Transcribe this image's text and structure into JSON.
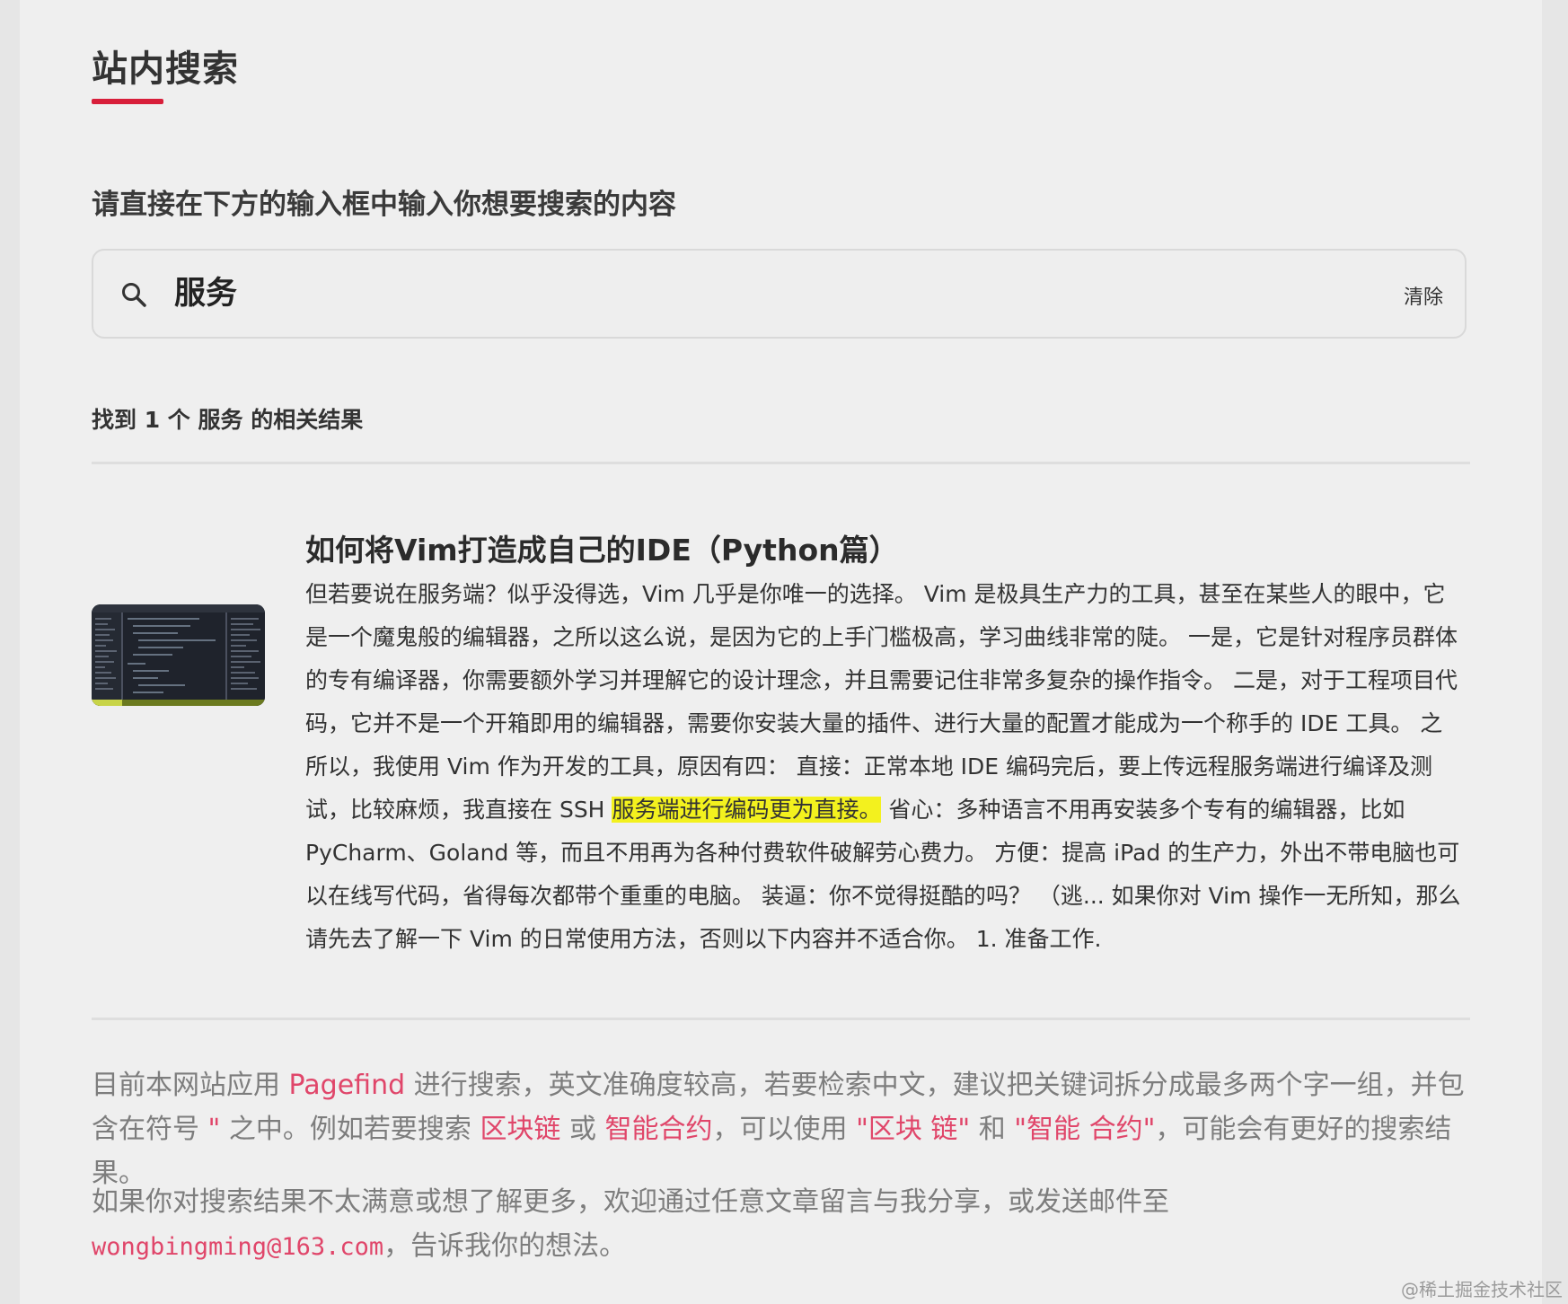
{
  "page": {
    "title": "站内搜索",
    "prompt": "请直接在下方的输入框中输入你想要搜索的内容"
  },
  "search": {
    "value": "服务",
    "clear_label": "清除",
    "icon": "search-icon"
  },
  "results": {
    "count_text": "找到 1 个 服务 的相关结果",
    "items": [
      {
        "title": "如何将Vim打造成自己的IDE（Python篇）",
        "thumbnail": "vim-editor-screenshot",
        "excerpt_before": "但若要说在服务端？似乎没得选，Vim 几乎是你唯一的选择。 Vim 是极具生产力的工具，甚至在某些人的眼中，它是一个魔鬼般的编辑器，之所以这么说，是因为它的上手门槛极高，学习曲线非常的陡。 一是，它是针对程序员群体的专有编译器，你需要额外学习并理解它的设计理念，并且需要记住非常多复杂的操作指令。 二是，对于工程项目代码，它并不是一个开箱即用的编辑器，需要你安装大量的插件、进行大量的配置才能成为一个称手的 IDE 工具。 之所以，我使用 Vim 作为开发的工具，原因有四： 直接：正常本地 IDE 编码完后，要上传远程服务端进行编译及测试，比较麻烦，我直接在 SSH ",
        "excerpt_highlight": "服务端进行编码更为直接。",
        "excerpt_after": " 省心：多种语言不用再安装多个专有的编辑器，比如 PyCharm、Goland 等，而且不用再为各种付费软件破解劳心费力。 方便：提高 iPad 的生产力，外出不带电脑也可以在线写代码，省得每次都带个重重的电脑。 装逼：你不觉得挺酷的吗？ （逃... 如果你对 Vim 操作一无所知，那么请先去了解一下 Vim 的日常使用方法，否则以下内容并不适合你。 1. 准备工作."
      }
    ]
  },
  "footer": {
    "note1_a": "目前本网站应用 ",
    "note1_link": "Pagefind",
    "note1_b": " 进行搜索，英文准确度较高，若要检索中文，建议把关键词拆分成最多两个字一组，并包含在符号 ",
    "note1_quote": "\"",
    "note1_c": " 之中。例如若要搜索 ",
    "note1_ex1": "区块链",
    "note1_d": " 或 ",
    "note1_ex2": "智能合约",
    "note1_e": "，可以使用 ",
    "note1_ex3": "\"区块 链\"",
    "note1_f": " 和 ",
    "note1_ex4": "\"智能 合约\"",
    "note1_g": "，可能会有更好的搜索结果。",
    "note2_a": "如果你对搜索结果不太满意或想了解更多，欢迎通过任意文章留言与我分享，或发送邮件至",
    "note2_email": "wongbingming@163.com",
    "note2_b": "，告诉我你的想法。"
  },
  "watermark": "@稀土掘金技术社区",
  "colors": {
    "accent": "#d81e3a",
    "link": "#e0466a",
    "highlight": "#f3f11e",
    "background": "#efefef"
  }
}
